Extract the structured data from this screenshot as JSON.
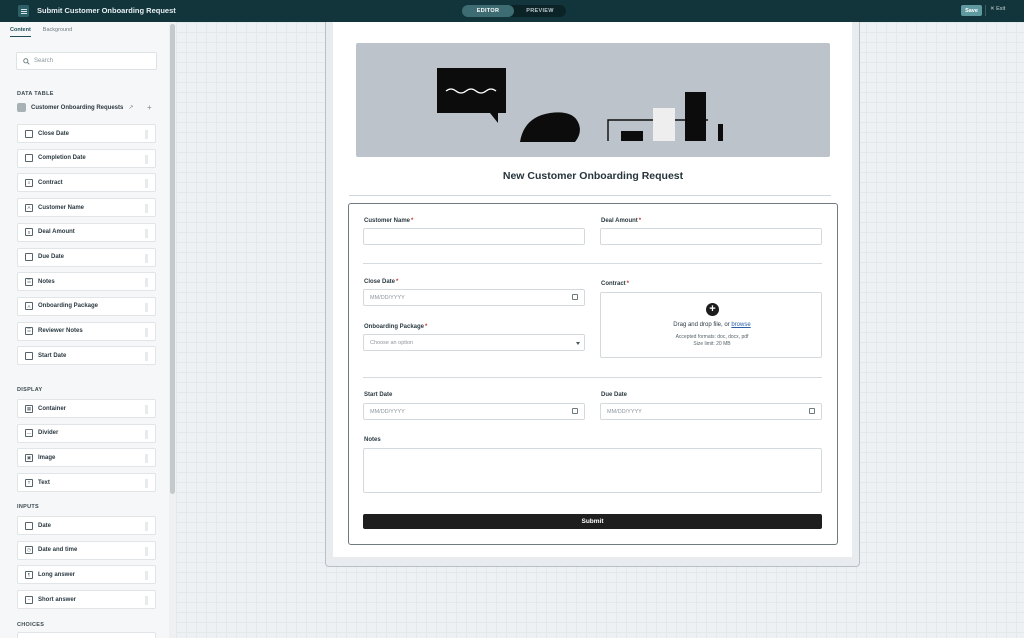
{
  "header": {
    "title": "Submit Customer Onboarding Request",
    "modes": [
      "EDITOR",
      "PREVIEW"
    ],
    "active_mode": "EDITOR",
    "save_label": "Save",
    "exit_label": "Exit"
  },
  "sidebar": {
    "tabs": [
      "Content",
      "Background"
    ],
    "search_placeholder": "Search",
    "data_table_label": "DATA TABLE",
    "table_name": "Customer Onboarding Requests",
    "data_fields": [
      {
        "label": "Close Date",
        "icon": "calendar-icon"
      },
      {
        "label": "Completion Date",
        "icon": "calendar-icon"
      },
      {
        "label": "Contract",
        "icon": "file-icon"
      },
      {
        "label": "Customer Name",
        "icon": "text-field-icon"
      },
      {
        "label": "Deal Amount",
        "icon": "number-icon"
      },
      {
        "label": "Due Date",
        "icon": "calendar-icon"
      },
      {
        "label": "Notes",
        "icon": "long-text-icon"
      },
      {
        "label": "Onboarding Package",
        "icon": "text-field-icon"
      },
      {
        "label": "Reviewer Notes",
        "icon": "long-text-icon"
      },
      {
        "label": "Start Date",
        "icon": "calendar-icon"
      }
    ],
    "display_label": "DISPLAY",
    "display_items": [
      {
        "label": "Container",
        "icon": "container-icon"
      },
      {
        "label": "Divider",
        "icon": "divider-icon"
      },
      {
        "label": "Image",
        "icon": "image-icon"
      },
      {
        "label": "Text",
        "icon": "text-icon"
      }
    ],
    "inputs_label": "INPUTS",
    "input_items": [
      {
        "label": "Date",
        "icon": "calendar-icon"
      },
      {
        "label": "Date and time",
        "icon": "datetime-icon"
      },
      {
        "label": "Long answer",
        "icon": "long-answer-icon"
      },
      {
        "label": "Short answer",
        "icon": "short-answer-icon"
      }
    ],
    "choices_label": "CHOICES"
  },
  "form": {
    "title": "New Customer Onboarding Request",
    "customer_name_label": "Customer Name",
    "deal_amount_label": "Deal Amount",
    "close_date_label": "Close Date",
    "close_date_placeholder": "MM/DD/YYYY",
    "contract_label": "Contract",
    "onboarding_package_label": "Onboarding Package",
    "onboarding_package_placeholder": "Choose an option",
    "upload_text": "Drag and drop file, or",
    "upload_link": "browse",
    "accepted_formats": "Accepted formats: doc, docx, pdf",
    "size_limit": "Size limit: 20 MB",
    "start_date_label": "Start Date",
    "start_date_placeholder": "MM/DD/YYYY",
    "due_date_label": "Due Date",
    "due_date_placeholder": "MM/DD/YYYY",
    "notes_label": "Notes",
    "submit_label": "Submit",
    "required_mark": "*"
  }
}
